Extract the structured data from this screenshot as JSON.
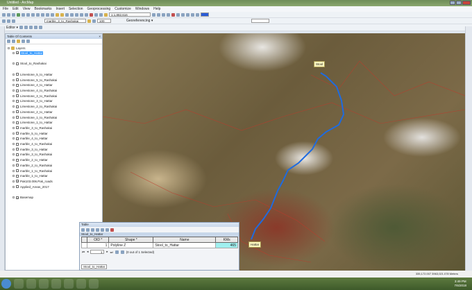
{
  "window": {
    "title": "Untitled - ArcMap"
  },
  "menu": [
    "File",
    "Edit",
    "View",
    "Bookmarks",
    "Insert",
    "Selection",
    "Geoprocessing",
    "Customize",
    "Windows",
    "Help"
  ],
  "toolbar": {
    "scale": "1:1,882,616",
    "layer_combo": "marble_3_to_Rashakai",
    "zoom_pct": "100",
    "georef_label": "Georeferencing ▾",
    "editor_label": "Editor ▾"
  },
  "toc": {
    "title": "Table Of Contents",
    "root": "Layers",
    "layers": [
      {
        "name": "Stool_to_Hattar",
        "checked": true,
        "selected": true
      },
      {
        "name": "Stool_to_Rashakai",
        "checked": false
      },
      {
        "name": "Limestone_5_to_Hattar",
        "checked": false
      },
      {
        "name": "Limestone_5_to_Rashakai",
        "checked": false
      },
      {
        "name": "Limestone_4_to_Hattar",
        "checked": false
      },
      {
        "name": "Limestone_4_to_Rashakai",
        "checked": false
      },
      {
        "name": "Limestone_3_to_Rashakai",
        "checked": false
      },
      {
        "name": "Limestone_3_to_Hattar",
        "checked": false
      },
      {
        "name": "Limestone_2_to_Rashakai",
        "checked": false
      },
      {
        "name": "Limestone_2_to_Hattar",
        "checked": false
      },
      {
        "name": "Limestone_1_to_Rashakai",
        "checked": false
      },
      {
        "name": "Limestone_1_to_Hattar",
        "checked": false
      },
      {
        "name": "marble_3_to_Rashakai",
        "checked": false
      },
      {
        "name": "marble_5_to_Hattar",
        "checked": false
      },
      {
        "name": "marble_4_to_Hattar",
        "checked": false
      },
      {
        "name": "marble_4_to_Rashakai",
        "checked": false
      },
      {
        "name": "marble_3_to_Hattar",
        "checked": false
      },
      {
        "name": "marble_3_to_Rashakai",
        "checked": false
      },
      {
        "name": "marble_2_to_Hattar",
        "checked": false
      },
      {
        "name": "marble_2_to_Rashakai",
        "checked": false
      },
      {
        "name": "marble_1_to_Rashakai",
        "checked": false
      },
      {
        "name": "marble_1_to_Hattar",
        "checked": false
      },
      {
        "name": "Pak103.006.Pak_roads",
        "checked": true
      },
      {
        "name": "Applied_Areas_2017",
        "checked": false
      },
      {
        "name": "Basemap",
        "checked": true
      }
    ]
  },
  "map": {
    "labels": {
      "start": "Stool",
      "end": "Hattar"
    },
    "route_color": "#1e6be0"
  },
  "table": {
    "title": "Table",
    "tab": "Stool_to_Hattar",
    "columns": [
      "OID *",
      "Shape *",
      "Name",
      "KMs"
    ],
    "rows": [
      [
        "1",
        "Polyline Z",
        "Stool_to_Hattar",
        "465"
      ]
    ],
    "nav": {
      "record": "1",
      "status": "(0 out of 1 Selected)"
    },
    "bottom_tab": "Stool_to_Hattar"
  },
  "status": {
    "coords": "335,172.007  3963,021.078 Meters"
  },
  "taskbar": {
    "time": "3:49 PM",
    "date": "7/6/2018"
  }
}
